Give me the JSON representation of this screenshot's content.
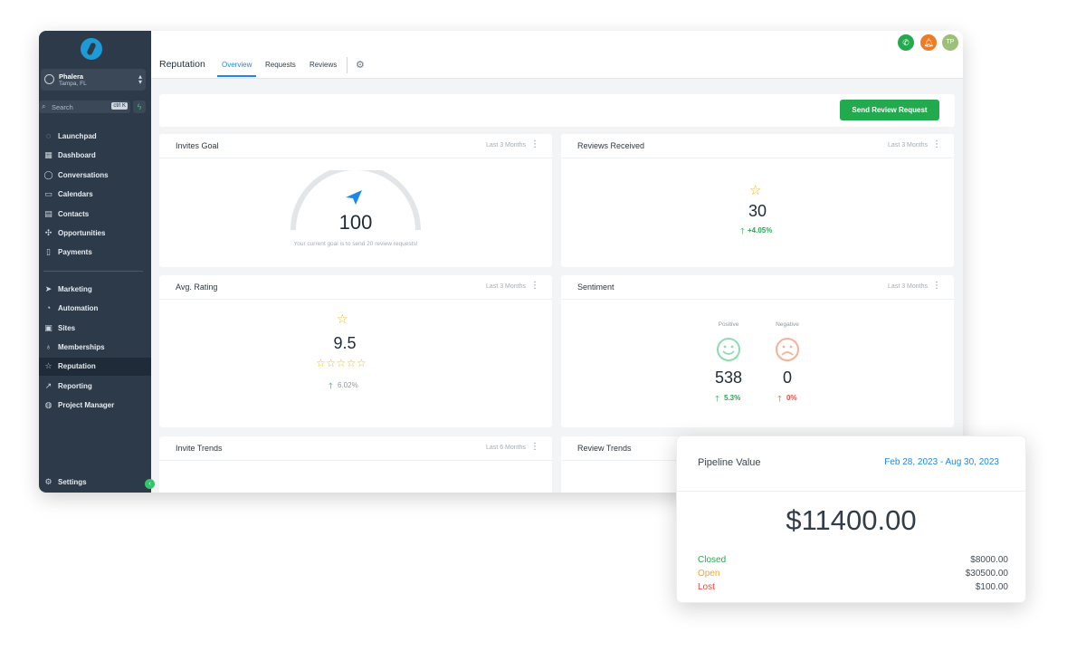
{
  "sidebar": {
    "account": {
      "name": "Phalera",
      "location": "Tampa, FL"
    },
    "search": {
      "placeholder": "Search",
      "shortcut": "ctrl K"
    },
    "items_top": [
      {
        "label": "Launchpad",
        "icon": "rocket-icon"
      },
      {
        "label": "Dashboard",
        "icon": "grid-icon"
      },
      {
        "label": "Conversations",
        "icon": "chat-icon"
      },
      {
        "label": "Calendars",
        "icon": "calendar-icon"
      },
      {
        "label": "Contacts",
        "icon": "contacts-icon"
      },
      {
        "label": "Opportunities",
        "icon": "opportunities-icon"
      },
      {
        "label": "Payments",
        "icon": "payments-icon"
      }
    ],
    "items_bottom": [
      {
        "label": "Marketing",
        "icon": "send-icon"
      },
      {
        "label": "Automation",
        "icon": "automation-icon"
      },
      {
        "label": "Sites",
        "icon": "sites-icon"
      },
      {
        "label": "Memberships",
        "icon": "memberships-icon"
      },
      {
        "label": "Reputation",
        "icon": "star-icon",
        "active": true
      },
      {
        "label": "Reporting",
        "icon": "trend-icon"
      },
      {
        "label": "Project Manager",
        "icon": "project-icon"
      }
    ],
    "settings_label": "Settings"
  },
  "header": {
    "title": "Reputation",
    "tabs": [
      "Overview",
      "Requests",
      "Reviews"
    ],
    "selected_tab": "Overview",
    "user_initials": "TP",
    "colors": {
      "phone": "#23a94e",
      "bell": "#f07b22",
      "avatar": "#9dbf7a"
    }
  },
  "actions": {
    "send_review_request": "Send Review Request"
  },
  "cards": {
    "invites_goal": {
      "title": "Invites Goal",
      "period": "Last 3 Months",
      "value": "100",
      "caption": "Your current goal is to send 20 review requests!"
    },
    "reviews_received": {
      "title": "Reviews Received",
      "period": "Last 3 Months",
      "value": "30",
      "change": "+4.05%"
    },
    "avg_rating": {
      "title": "Avg. Rating",
      "period": "Last 3 Months",
      "value": "9.5",
      "stars": 5,
      "change": "6.02%"
    },
    "sentiment": {
      "title": "Sentiment",
      "period": "Last 3 Months",
      "positive": {
        "label": "Positive",
        "value": "538",
        "change": "5.3%"
      },
      "negative": {
        "label": "Negative",
        "value": "0",
        "change": "0%"
      }
    },
    "invite_trends": {
      "title": "Invite Trends",
      "period": "Last 6 Months"
    },
    "review_trends": {
      "title": "Review Trends"
    }
  },
  "pipeline": {
    "title": "Pipeline Value",
    "date_range": "Feb 28, 2023 - Aug 30, 2023",
    "total": "$11400.00",
    "rows": [
      {
        "label": "Closed",
        "value": "$8000.00",
        "color": "#23a94e"
      },
      {
        "label": "Open",
        "value": "$30500.00",
        "color": "#f5a623"
      },
      {
        "label": "Lost",
        "value": "$100.00",
        "color": "#e5483d"
      }
    ]
  }
}
